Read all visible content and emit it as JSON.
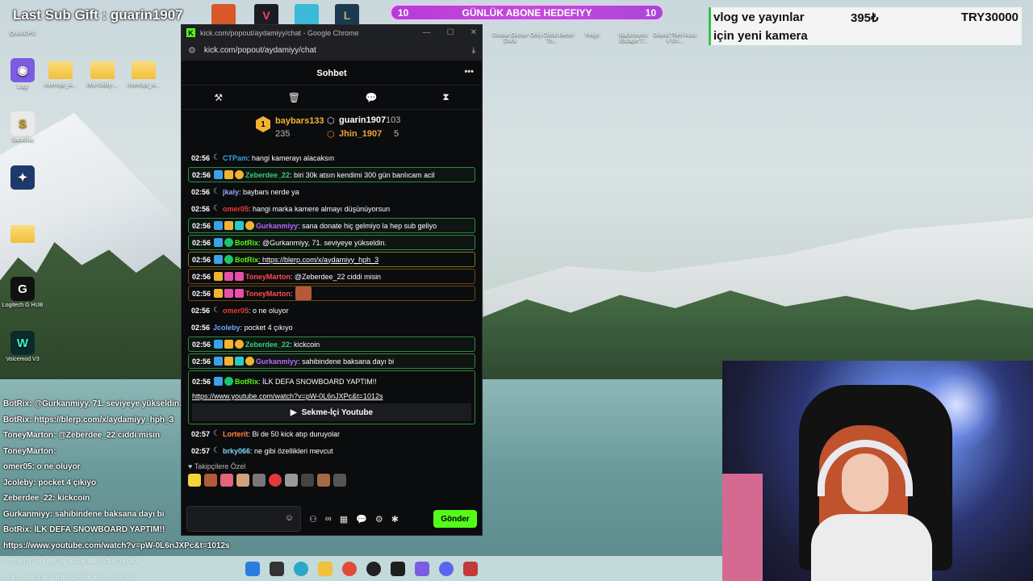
{
  "overlay": {
    "sub_gift": "Last Sub Gift : guarin1907",
    "goal_left": "10",
    "goal_title": "GÜNLÜK ABONE HEDEFIYY",
    "goal_right": "10",
    "donate_line1": "vlog ve yayınlar",
    "donate_line2": "için yeni kamera",
    "donate_current": "395₺",
    "donate_target": "TRY30000"
  },
  "desktop_icons": [
    {
      "label": "QuickCPU"
    },
    {
      "label": "Logi"
    },
    {
      "label": "Interrupt_A..."
    },
    {
      "label": "Msi-Utility-..."
    },
    {
      "label": "Interrupt_A..."
    },
    {
      "label": "Sanalika"
    },
    {
      "label": "Logitech G HUB"
    },
    {
      "label": "Voicemod V3"
    },
    {
      "label": "Goose Goose Duck"
    },
    {
      "label": "Only Climb Better To..."
    },
    {
      "label": "Feign"
    },
    {
      "label": "Backrooms Escape T..."
    },
    {
      "label": "Grand Theft Auto V En..."
    }
  ],
  "browser": {
    "window_title": "kick.com/popout/aydamiyy/chat - Google Chrome",
    "url": "kick.com/popout/aydamiyy/chat"
  },
  "chat": {
    "header": "Sohbet",
    "more": "•••",
    "leaderboard": {
      "first_rank": "1",
      "first_name": "baybars133",
      "first_value": "235",
      "second_name": "guarin1907",
      "second_value": "103",
      "third_name": "Jhin_1907",
      "third_value": "5"
    },
    "messages": [
      {
        "time": "02:56",
        "user": "CTPam",
        "text": ": hangi kamerayı alacaksın",
        "color": "#3ba1e8"
      },
      {
        "time": "02:56",
        "user": "Zeberdee_22",
        "text": ": biri 30k atsın kendimi 300 gün banlıcam acil",
        "color": "#34d07a"
      },
      {
        "time": "02:56",
        "user": "jkaiy",
        "text": ": baybars nerde ya",
        "color": "#9aa6ff"
      },
      {
        "time": "02:56",
        "user": "omer05",
        "text": ": hangi marka kamere almayı düşünüyorsun",
        "color": "#ef3a3a"
      },
      {
        "time": "02:56",
        "user": "Gurkanmiyy",
        "text": ": sana donate hiç gelmiyo la hep sub geliyo",
        "color": "#b767ff"
      },
      {
        "time": "02:56",
        "user": "BotRix",
        "text": ": @Gurkanmiyy, 71. seviyeye yükseldin.",
        "color": "#53fc18"
      },
      {
        "time": "02:56",
        "user": "BotRix",
        "text": ": https://blerp.com/x/aydamiyy_hph_3",
        "color": "#53fc18"
      },
      {
        "time": "02:56",
        "user": "ToneyMarton",
        "text": ": @Zeberdee_22 ciddi misin",
        "color": "#ff4d4d"
      },
      {
        "time": "02:56",
        "user": "ToneyMarton",
        "text": ":",
        "color": "#ff4d4d"
      },
      {
        "time": "02:56",
        "user": "omer05",
        "text": ": o ne oluyor",
        "color": "#ef3a3a"
      },
      {
        "time": "02:56",
        "user": "Jcoleby",
        "text": ": pocket 4 çıkıyo",
        "color": "#6ea8ff"
      },
      {
        "time": "02:56",
        "user": "Zeberdee_22",
        "text": ": kickcoin",
        "color": "#34d07a"
      },
      {
        "time": "02:56",
        "user": "Gurkanmiyy",
        "text": ": sahibindene baksana dayı bi",
        "color": "#b767ff"
      },
      {
        "time": "02:56",
        "user": "BotRix",
        "text": ": İLK DEFA SNOWBOARD YAPTIM!!",
        "color": "#53fc18"
      }
    ],
    "yt_url": "https://www.youtube.com/watch?v=pW-0L6nJXPc&t=1012s",
    "yt_button": "Sekme-İçi Youtube",
    "later_messages": [
      {
        "time": "02:57",
        "user": "Lorterit",
        "text": ": Bi de 50 kick atıp duruyolar",
        "color": "#ff8a3d"
      },
      {
        "time": "02:57",
        "user": "brky066",
        "text": ": ne gibi özellikleri mevcut",
        "color": "#7fd6ff"
      }
    ],
    "emote_section": "Takipçilere Özel",
    "input_placeholder": "",
    "send_label": "Gönder"
  },
  "stream_overlay_chat": [
    "BotRix: @Gurkanmiyy, 71. seviyeye yükseldin.",
    "BotRix: https://blerp.com/x/aydamiyy_hph_3",
    "ToneyMarton: @Zeberdee_22 ciddi misin",
    "ToneyMarton:",
    "omer05: o ne oluyor",
    "Jcoleby: pocket 4 çıkıyo",
    "Zeberdee_22: kickcoin",
    "Gurkanmiyy: sahibindene baksana dayı bi",
    "BotRix: İLK DEFA SNOWBOARD YAPTIM!!",
    "https://www.youtube.com/watch?v=pW-0L6nJXPc&t=1012s",
    "Lorterit: Bi de 50 kick atıp duruyolar",
    "brky066: ne gibi özellikleri mevcut"
  ],
  "colors": {
    "kick_green": "#53fc18",
    "goal_purple": "#c54bd9"
  }
}
